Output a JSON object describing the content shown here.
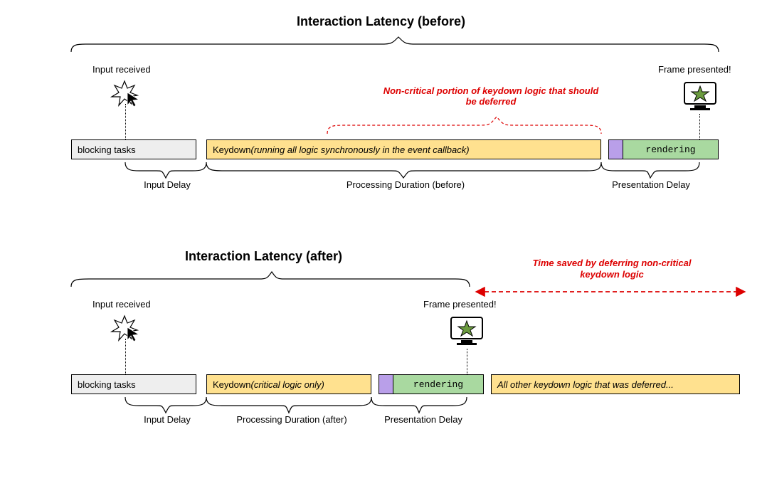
{
  "before": {
    "title": "Interaction Latency (before)",
    "inputReceived": "Input received",
    "framePresented": "Frame presented!",
    "annotation": "Non-critical portion of keydown logic that should be deferred",
    "segments": {
      "blocking": "blocking tasks",
      "keydownPrefix": "Keydown ",
      "keydownItalic": "(running all logic synchronously in the event callback)",
      "rendering": "rendering"
    },
    "below": {
      "inputDelay": "Input Delay",
      "processing": "Processing Duration (before)",
      "presentation": "Presentation Delay"
    }
  },
  "after": {
    "title": "Interaction Latency (after)",
    "inputReceived": "Input received",
    "framePresented": "Frame presented!",
    "timeSaved": "Time saved by deferring non-critical keydown logic",
    "segments": {
      "blocking": "blocking tasks",
      "keydownPrefix": "Keydown ",
      "keydownItalic": "(critical logic only)",
      "rendering": "rendering",
      "deferred": "All other keydown logic that was deferred..."
    },
    "below": {
      "inputDelay": "Input Delay",
      "processing": "Processing Duration (after)",
      "presentation": "Presentation Delay"
    }
  }
}
